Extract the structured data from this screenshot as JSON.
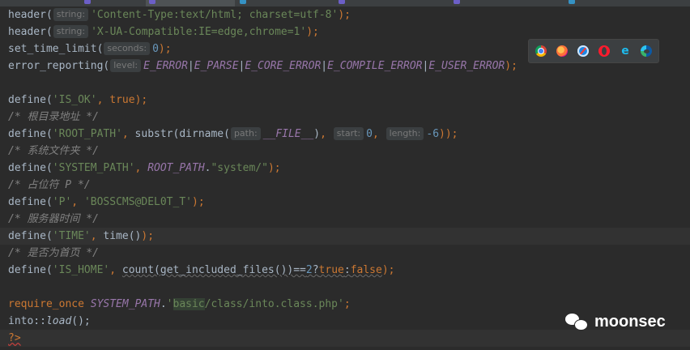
{
  "window": {
    "title": ""
  },
  "tabs": [
    {
      "label": ""
    },
    {
      "label": ""
    },
    {
      "label": ""
    },
    {
      "label": ""
    },
    {
      "label": ""
    },
    {
      "label": ""
    },
    {
      "label": ""
    },
    {
      "label": ""
    }
  ],
  "code": {
    "l1": {
      "fn": "header(",
      "hint": "string:",
      "str": "'Content-Type:text/html; charset=utf-8'",
      "end": ");"
    },
    "l2": {
      "fn": "header(",
      "hint": "string:",
      "str": "'X-UA-Compatible:IE=edge,chrome=1'",
      "end": ");"
    },
    "l3": {
      "fn": "set_time_limit(",
      "hint": "seconds:",
      "num": "0",
      "end": ");"
    },
    "l4": {
      "fn": "error_reporting(",
      "hint": "level:",
      "c1": "E_ERROR",
      "c2": "E_PARSE",
      "c3": "E_CORE_ERROR",
      "c4": "E_COMPILE_ERROR",
      "c5": "E_USER_ERROR",
      "pipe": "|",
      "end": ");"
    },
    "l6": {
      "fn": "define(",
      "str": "'IS_OK'",
      "comma": ", ",
      "kw": "true",
      "end": ");"
    },
    "l7": {
      "cmt": "/* 根目录地址 */"
    },
    "l8": {
      "fn": "define(",
      "str": "'ROOT_PATH'",
      "comma": ", ",
      "fn2": "substr(dirname(",
      "hint1": "path:",
      "c1": "__FILE__",
      "close": ")",
      "comma2": ", ",
      "hint2": "start:",
      "num1": "0",
      "comma3": ", ",
      "hint3": "length:",
      "num2": "-6",
      "end": "));"
    },
    "l9": {
      "cmt": "/* 系统文件夹 */"
    },
    "l10": {
      "fn": "define(",
      "str": "'SYSTEM_PATH'",
      "comma": ", ",
      "c1": "ROOT_PATH",
      "dot": ".",
      "str2": "\"system/\"",
      "end": ");"
    },
    "l11": {
      "cmt": "/* 占位符 P */"
    },
    "l12": {
      "fn": "define(",
      "str": "'P'",
      "comma": ", ",
      "str2": "'BOSSCMS@DEL0T_T'",
      "end": ");"
    },
    "l13": {
      "cmt": "/* 服务器时间 */"
    },
    "l14": {
      "fn": "define(",
      "str": "'TIME'",
      "comma": ", ",
      "fn2": "time()",
      "end": ");"
    },
    "l15": {
      "cmt": "/* 是否为首页 */"
    },
    "l16": {
      "fn": "define(",
      "str": "'IS_HOME'",
      "comma": ", ",
      "fn2": "count(get_included_files())==",
      "num": "2",
      "q": "?",
      "kw1": "true",
      "colon": ":",
      "kw2": "false",
      "end": ");"
    },
    "l18": {
      "kw": "require_once",
      "sp": " ",
      "c1": "SYSTEM_PATH",
      "dot": ".",
      "str_a": "'",
      "str_hl": "basic",
      "str_b": "/class/into.class.php'",
      "end": ";"
    },
    "l19": {
      "fn": "into::",
      "m": "load",
      "end": "();"
    },
    "l20": {
      "tag": "?>"
    }
  },
  "browsers": [
    "chrome-icon",
    "firefox-icon",
    "safari-icon",
    "opera-icon",
    "ie-icon",
    "edge-icon"
  ],
  "watermark": {
    "text": "moonsec"
  },
  "colors": {
    "background": "#2b2b2b",
    "string": "#6a8759",
    "keyword": "#cc7832",
    "constant": "#9876aa",
    "number": "#6897bb",
    "comment": "#808080",
    "text": "#a9b7c6"
  }
}
